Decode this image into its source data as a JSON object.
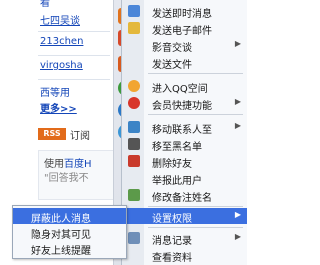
{
  "background": {
    "links": [
      "看",
      "七四吴谈",
      "213chen",
      "virgosha",
      "西等用"
    ],
    "more": "更多>>",
    "rss_badge": "RSS",
    "rss_text": "订阅",
    "message": {
      "line1_prefix": "使用",
      "line1_link": "百度H",
      "line2": "\"回答我不",
      "line3": ""
    }
  },
  "context_menu": {
    "items": [
      {
        "label": "发送即时消息",
        "icon": "chat-icon",
        "has_submenu": false
      },
      {
        "label": "发送电子邮件",
        "icon": "email-icon",
        "has_submenu": false
      },
      {
        "label": "影音交谈",
        "icon": "video-icon",
        "has_submenu": true
      },
      {
        "label": "发送文件",
        "icon": "file-icon",
        "has_submenu": false
      },
      {
        "label": "进入QQ空间",
        "icon": "qzone-icon",
        "has_submenu": false
      },
      {
        "label": "会员快捷功能",
        "icon": "member-icon",
        "has_submenu": true
      },
      {
        "label": "移动联系人至",
        "icon": "move-contact-icon",
        "has_submenu": true
      },
      {
        "label": "移至黑名单",
        "icon": "blacklist-icon",
        "has_submenu": false
      },
      {
        "label": "删除好友",
        "icon": "delete-friend-icon",
        "has_submenu": false
      },
      {
        "label": "举报此用户",
        "icon": "report-icon",
        "has_submenu": false
      },
      {
        "label": "修改备注姓名",
        "icon": "edit-name-icon",
        "has_submenu": false
      },
      {
        "label": "设置权限",
        "icon": "permission-icon",
        "has_submenu": true
      },
      {
        "label": "消息记录",
        "icon": "history-icon",
        "has_submenu": true
      },
      {
        "label": "查看资料",
        "icon": "profile-icon",
        "has_submenu": false
      }
    ],
    "highlighted": "设置权限"
  },
  "submenu": {
    "items": [
      "屏蔽此人消息",
      "隐身对其可见",
      "好友上线提醒"
    ],
    "highlighted": "屏蔽此人消息"
  },
  "toolbar": {
    "icons": [
      "qq-icon",
      "book-icon",
      "game-icon",
      "music-icon",
      "penguin-icon",
      "add-icon"
    ]
  },
  "colors": {
    "highlight": "#3b6fe0",
    "menu_bg": "#f6f8fb",
    "link": "#1446b8",
    "rss": "#e26b1a"
  }
}
